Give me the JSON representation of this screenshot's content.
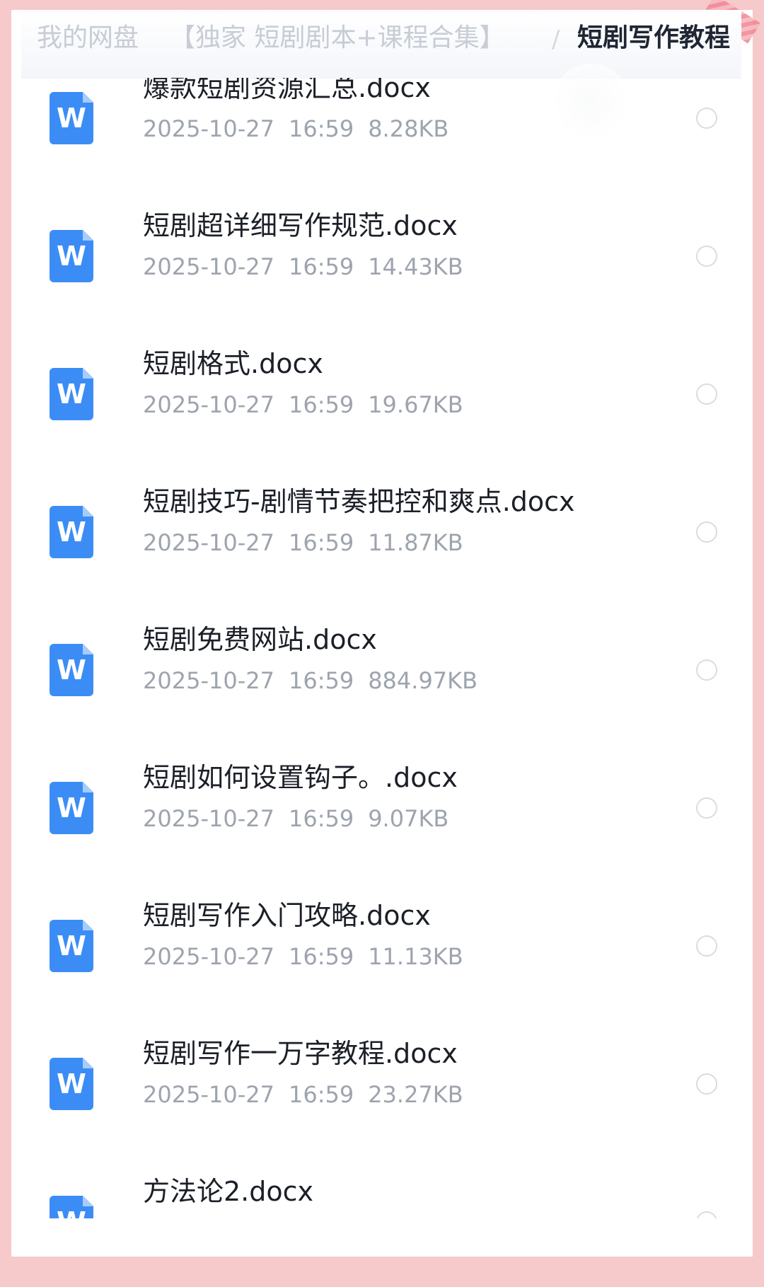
{
  "breadcrumb": {
    "root": "我的网盘",
    "parent": "【独家 短剧剧本+课程合集】",
    "separator": "/",
    "current": "短剧写作教程"
  },
  "files": [
    {
      "name": "爆款短剧资源汇总.docx",
      "date": "2025-10-27",
      "time": "16:59",
      "size": "8.28KB"
    },
    {
      "name": "短剧超详细写作规范.docx",
      "date": "2025-10-27",
      "time": "16:59",
      "size": "14.43KB"
    },
    {
      "name": "短剧格式.docx",
      "date": "2025-10-27",
      "time": "16:59",
      "size": "19.67KB"
    },
    {
      "name": "短剧技巧-剧情节奏把控和爽点.docx",
      "date": "2025-10-27",
      "time": "16:59",
      "size": "11.87KB"
    },
    {
      "name": "短剧免费网站.docx",
      "date": "2025-10-27",
      "time": "16:59",
      "size": "884.97KB"
    },
    {
      "name": "短剧如何设置钩子。.docx",
      "date": "2025-10-27",
      "time": "16:59",
      "size": "9.07KB"
    },
    {
      "name": "短剧写作入门攻略.docx",
      "date": "2025-10-27",
      "time": "16:59",
      "size": "11.13KB"
    },
    {
      "name": "短剧写作一万字教程.docx",
      "date": "2025-10-27",
      "time": "16:59",
      "size": "23.27KB"
    },
    {
      "name": "方法论2.docx"
    }
  ],
  "icon": {
    "name": "word-doc-icon",
    "letter": "W",
    "color": "#3b8df5"
  },
  "colors": {
    "background": "#f6c9cb",
    "card": "#ffffff",
    "title_text": "#1b1f27",
    "meta_text": "#9ea4ae"
  }
}
